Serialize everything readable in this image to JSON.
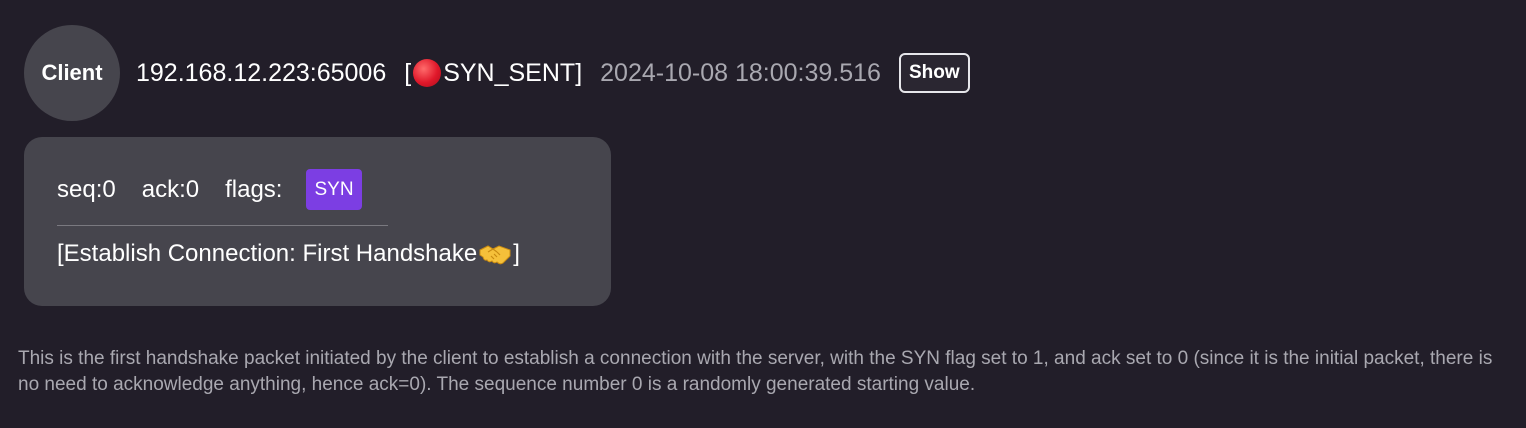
{
  "endpoint": {
    "role": "Client",
    "address": "192.168.12.223:65006",
    "state_open": "[",
    "state": "SYN_SENT",
    "state_close": "]",
    "status_icon": "red-circle-icon",
    "timestamp": "2024-10-08 18:00:39.516",
    "show_label": "Show"
  },
  "packet": {
    "seq_label": "seq:0",
    "ack_label": "ack:0",
    "flags_label": "flags:",
    "flags": [
      "SYN"
    ],
    "flag_color": "#7c3ee3",
    "note_prefix": "[Establish Connection: First Handshake",
    "note_icon": "handshake-icon",
    "note_suffix": "]"
  },
  "description": "This is the first handshake packet initiated by the client to establish a connection with the server, with the SYN flag set to 1, and ack set to 0 (since it is the initial packet, there is no need to acknowledge anything, hence ack=0). The sequence number 0 is a randomly generated starting value."
}
